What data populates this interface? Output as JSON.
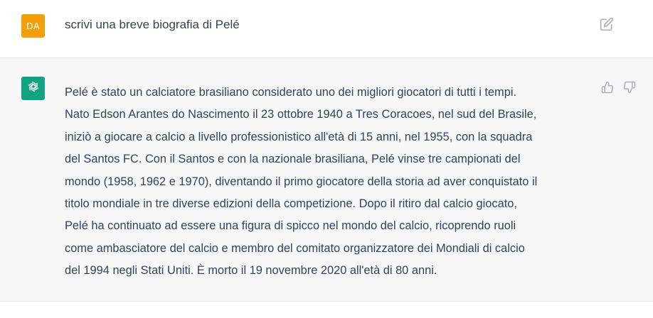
{
  "user_message": {
    "avatar_initials": "DA",
    "avatar_color": "#f59e0b",
    "text": "scrivi una breve biografia di Pelé",
    "edit_icon": "edit-icon"
  },
  "assistant_message": {
    "avatar_icon": "openai-logo-icon",
    "avatar_color": "#10a37f",
    "lines": [
      "Pelé è stato un calciatore brasiliano considerato uno dei migliori giocatori di tutti i tempi.",
      "Nato Edson Arantes do Nascimento il 23 ottobre 1940 a Tres Coracoes, nel sud del Brasile,",
      "iniziò a giocare a calcio a livello professionistico all'età di 15 anni, nel 1955, con la squadra",
      "del Santos FC. Con il Santos e con la nazionale brasiliana, Pelé vinse tre campionati del",
      "mondo (1958, 1962 e 1970), diventando il primo giocatore della storia ad aver conquistato il",
      "titolo mondiale in tre diverse edizioni della competizione. Dopo il ritiro dal calcio giocato,",
      "Pelé ha continuato ad essere una figura di spicco nel mondo del calcio, ricoprendo ruoli",
      "come ambasciatore del calcio e membro del comitato organizzatore dei Mondiali di calcio",
      "del 1994 negli Stati Uniti. È morto il 19 novembre 2020 all'età di 80 anni."
    ],
    "feedback_icons": [
      "thumbs-up-icon",
      "thumbs-down-icon"
    ]
  }
}
